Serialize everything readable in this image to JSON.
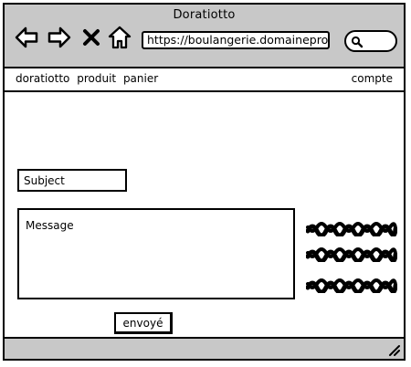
{
  "window": {
    "title": "Doratiotto"
  },
  "toolbar": {
    "back_icon": "arrow-left-icon",
    "forward_icon": "arrow-right-icon",
    "stop_icon": "close-icon",
    "home_icon": "home-icon",
    "url": "https://boulangerie.domaineproj",
    "search_icon": "search-icon"
  },
  "menu": {
    "items": [
      {
        "label": "doratiotto"
      },
      {
        "label": "produit"
      },
      {
        "label": "panier"
      }
    ],
    "account_label": "compte"
  },
  "form": {
    "subject_placeholder": "Subject",
    "message_placeholder": "Message",
    "send_label": "envoyé"
  },
  "colors": {
    "chrome_gray": "#c8c8c8",
    "stroke": "#000000",
    "background": "#ffffff"
  }
}
